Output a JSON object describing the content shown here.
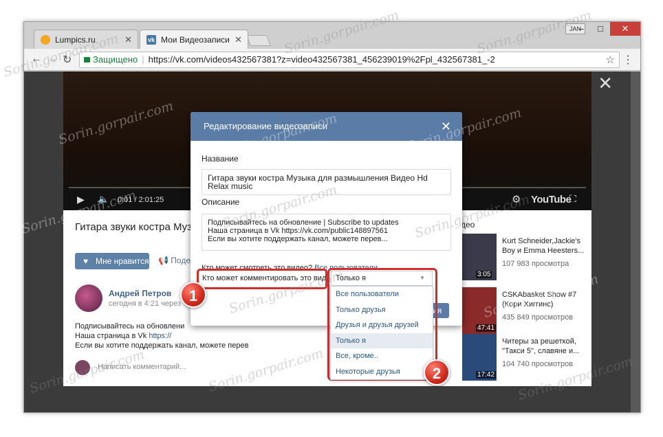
{
  "browser": {
    "tabs": [
      {
        "title": "Lumpics.ru",
        "favicon_color": "#f5a623"
      },
      {
        "title": "Мои Видеозаписи",
        "favicon_color": "#4a76a8"
      }
    ],
    "user_badge": "JAN",
    "window_buttons": {
      "minimize": "–",
      "maximize": "□",
      "close": "✕"
    },
    "secure_label": "Защищено",
    "url": "https://vk.com/videos432567381?z=video432567381_456239019%2Fpl_432567381_-2"
  },
  "player": {
    "time": "0:01 / 2:01:25",
    "logo": "YouTube"
  },
  "video_page": {
    "title": "Гитара звуки костра Музы Relax music",
    "like_label": "Мне нравится",
    "share_label": "Подел",
    "author": "Андрей Петров",
    "date": "сегодня в 4:21 через Yo",
    "description": "Подписывайтесь на обновлени\nНаша страница в Vk ",
    "description_link": "https://",
    "description_line3": "Если вы хотите поддержать канал, можете перев",
    "comment_placeholder": "Написать комментарий...",
    "related_suffix": "део",
    "related": [
      {
        "title": "Kurt Schneider,Jackie's Boy и Emma Heesters...",
        "views": "107 983 просмотра",
        "duration": "3:05",
        "thumb": "#3a3a4a"
      },
      {
        "title": "CSKAbasket Show #7 (Кори Хиггинс)",
        "views": "435 849 просмотров",
        "duration": "47:41",
        "thumb": "#8a2a2a"
      },
      {
        "title": "Читеры за решеткой, \"Такси 5\", славяне и...",
        "views": "104 740 просмотров",
        "duration": "17:42",
        "thumb": "#2a4a7a"
      }
    ]
  },
  "modal": {
    "title": "Редактирование видеозаписи",
    "name_label": "Название",
    "name_value": "Гитара звуки костра Музыка для размышления Видео Hd Relax music",
    "desc_label": "Описание",
    "desc_value": "Подписывайтесь на обновление | Subscribe to updates\nНаша страница в Vk https://vk.com/public148897561\nЕсли вы хотите поддержать канал, можете перев...",
    "view_privacy_label": "Кто может смотреть это видео?",
    "view_privacy_value": "Все пользователи",
    "comment_privacy_label": "Кто может комментировать это видео?",
    "comment_privacy_value": "Только я",
    "save_label": "ения"
  },
  "dropdown": {
    "options": [
      "Все пользователи",
      "Только друзья",
      "Друзья и друзья друзей",
      "Только я",
      "Все, кроме..",
      "Некоторые друзья"
    ],
    "selected_index": 3
  },
  "annotations": {
    "badge1": "1",
    "badge2": "2",
    "color": "#d42b2b"
  },
  "watermark": "Sorin.gorpair.com"
}
